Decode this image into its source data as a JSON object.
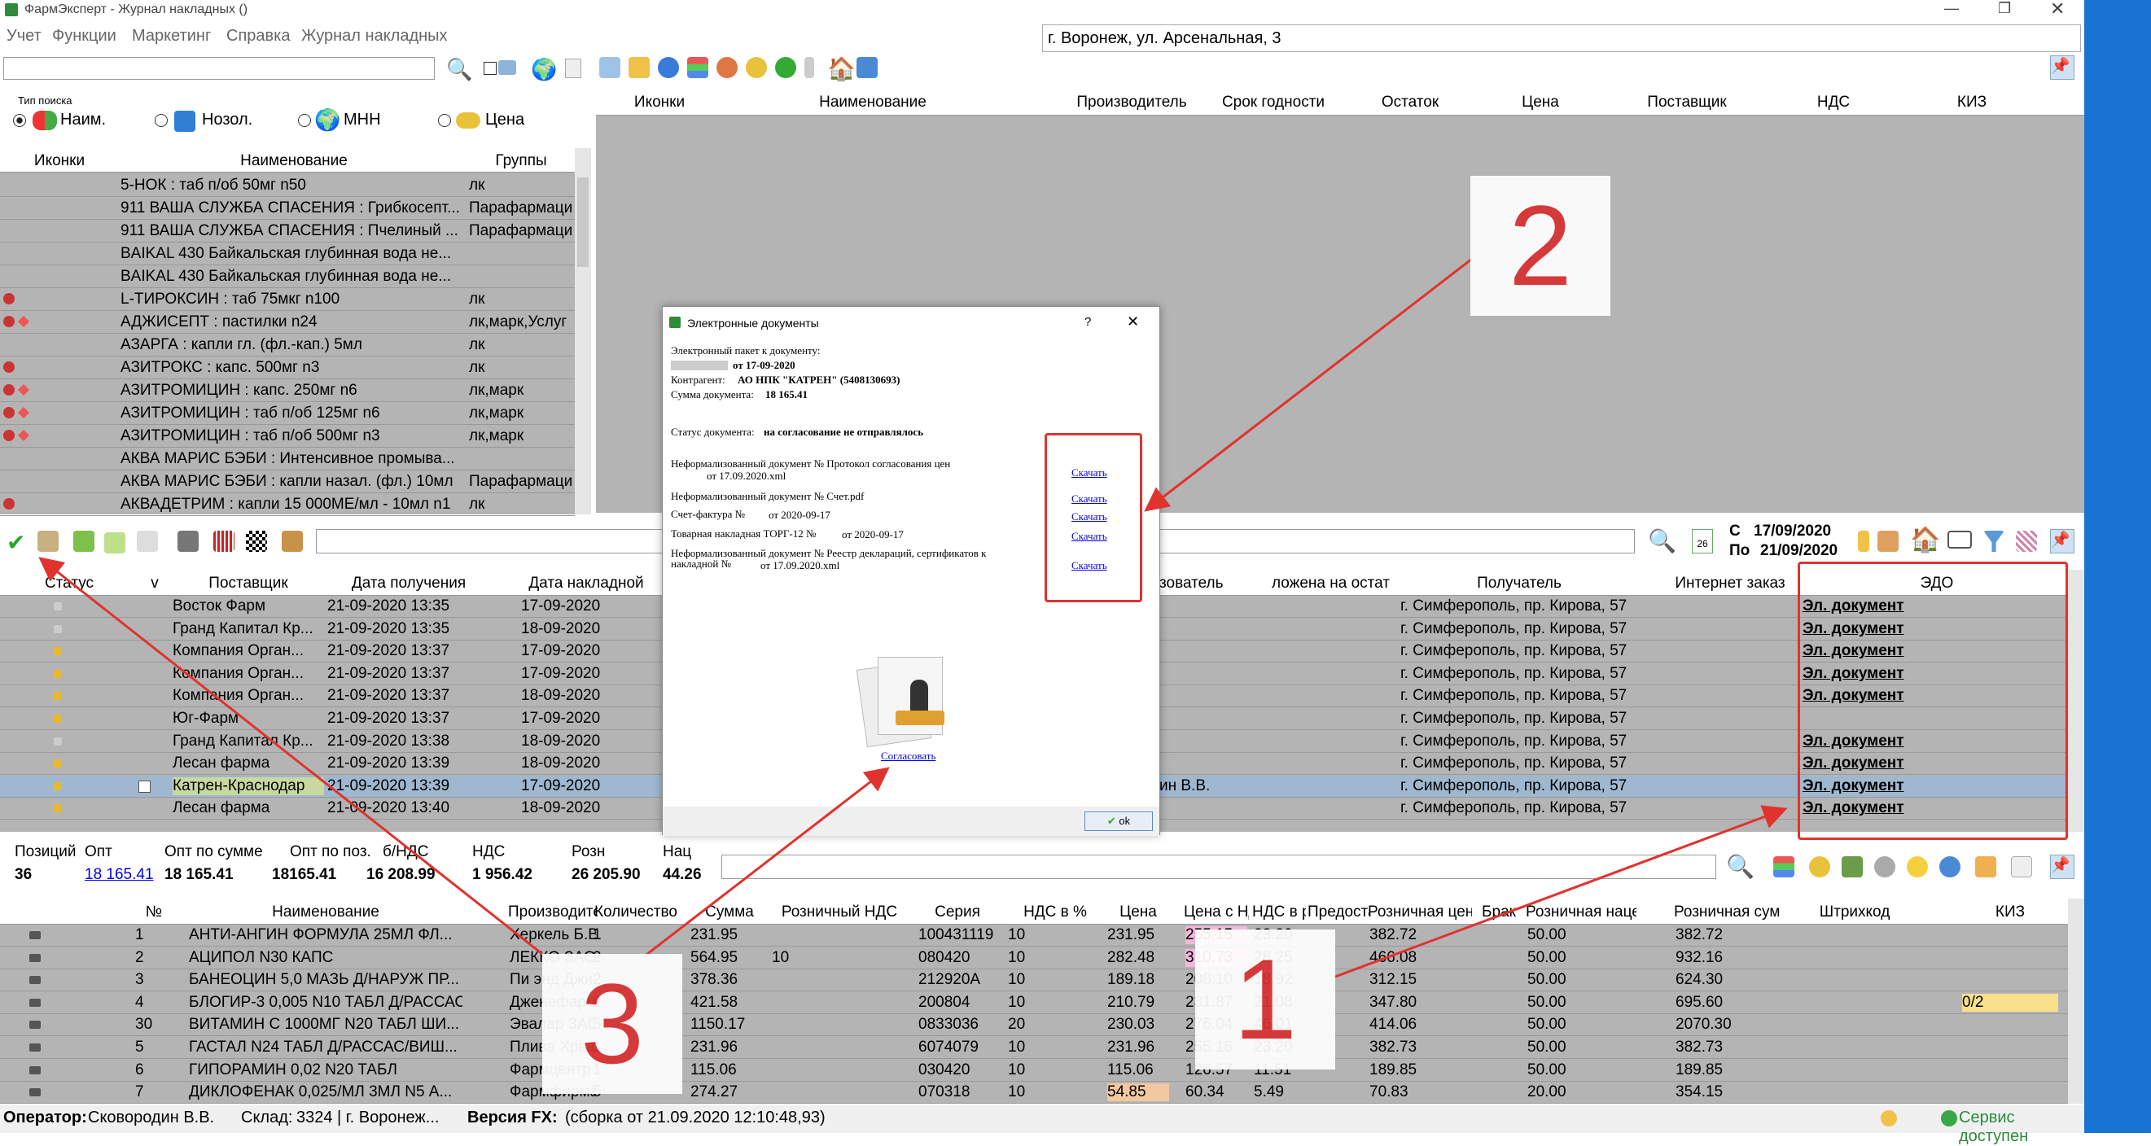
{
  "title": "ФармЭксперт - Журнал накладных ()",
  "menu": [
    "Учет",
    "Функции",
    "Маркетинг",
    "Справка",
    "Журнал накладных"
  ],
  "address": "г. Воронеж, ул. Арсенальная, 3",
  "search_type_label": "Тип поиска",
  "search_types": [
    "Наим.",
    "Нозол.",
    "МНН",
    "Цена"
  ],
  "top_cols": [
    "Иконки",
    "Наименование",
    "Производитель",
    "Срок годности",
    "Остаток",
    "Цена",
    "Поставщик",
    "НДС",
    "КИЗ"
  ],
  "left_cols": [
    "Иконки",
    "Наименование",
    "Группы"
  ],
  "left_rows": [
    {
      "name": "5-НОК : таб п/об 50мг n50",
      "grp": "лк"
    },
    {
      "name": "911 ВАША СЛУЖБА СПАСЕНИЯ : Грибкосепт...",
      "grp": "Парафармаци"
    },
    {
      "name": "911 ВАША СЛУЖБА СПАСЕНИЯ : Пчелиный ...",
      "grp": "Парафармаци"
    },
    {
      "name": "BAIKAL 430 Байкальская глубинная вода  не...",
      "grp": ""
    },
    {
      "name": "BAIKAL 430 Байкальская глубинная вода  не...",
      "grp": ""
    },
    {
      "name": "L-ТИРОКСИН : таб 75мкг n100",
      "grp": "лк"
    },
    {
      "name": "АДЖИСЕПТ : пастилки n24",
      "grp": "лк,марк,Услуг"
    },
    {
      "name": "АЗАРГА : капли гл. (фл.-кап.) 5мл",
      "grp": "лк"
    },
    {
      "name": "АЗИТРОКС : капс. 500мг n3",
      "grp": "лк"
    },
    {
      "name": "АЗИТРОМИЦИН : капс. 250мг n6",
      "grp": "лк,марк"
    },
    {
      "name": "АЗИТРОМИЦИН : таб п/об 125мг n6",
      "grp": "лк,марк"
    },
    {
      "name": "АЗИТРОМИЦИН : таб п/об 500мг n3",
      "grp": "лк,марк"
    },
    {
      "name": "АКВА МАРИС БЭБИ : Интенсивное промыва...",
      "grp": ""
    },
    {
      "name": "АКВА МАРИС БЭБИ : капли назал. (фл.) 10мл",
      "grp": "Парафармаци"
    },
    {
      "name": "АКВАДЕТРИМ : капли 15 000МЕ/мл - 10мл n1",
      "grp": "лк"
    }
  ],
  "date_from_label": "С",
  "date_from": "17/09/2020",
  "date_to_label": "По",
  "date_to": "21/09/2020",
  "cal_day": "26",
  "inv_cols": [
    "Статус",
    "v",
    "Поставщик",
    "Дата получения",
    "Дата накладной",
    "зователь",
    "ложена на остат",
    "Получатель",
    "Интернет заказ",
    "ЭДО"
  ],
  "inv_rows": [
    {
      "sup": "Восток Фарм",
      "recv": "21-09-2020 13:35",
      "inv": "17-09-2020",
      "user": "",
      "recp": "г. Симферополь, пр. Кирова, 57",
      "edo": "Эл. документ"
    },
    {
      "sup": "Гранд Капитал Кр...",
      "recv": "21-09-2020 13:35",
      "inv": "18-09-2020",
      "user": "",
      "recp": "г. Симферополь, пр. Кирова, 57",
      "edo": "Эл. документ"
    },
    {
      "sup": "Компания Орган...",
      "recv": "21-09-2020 13:37",
      "inv": "17-09-2020",
      "user": "",
      "recp": "г. Симферополь, пр. Кирова, 57",
      "edo": "Эл. документ"
    },
    {
      "sup": "Компания Орган...",
      "recv": "21-09-2020 13:37",
      "inv": "17-09-2020",
      "user": "",
      "recp": "г. Симферополь, пр. Кирова, 57",
      "edo": "Эл. документ"
    },
    {
      "sup": "Компания Орган...",
      "recv": "21-09-2020 13:37",
      "inv": "18-09-2020",
      "user": "",
      "recp": "г. Симферополь, пр. Кирова, 57",
      "edo": "Эл. документ"
    },
    {
      "sup": "Юг-Фарм",
      "recv": "21-09-2020 13:37",
      "inv": "17-09-2020",
      "user": "",
      "recp": "г. Симферополь, пр. Кирова, 57",
      "edo": ""
    },
    {
      "sup": "Гранд Капитал Кр...",
      "recv": "21-09-2020 13:38",
      "inv": "18-09-2020",
      "user": "",
      "recp": "г. Симферополь, пр. Кирова, 57",
      "edo": "Эл. документ"
    },
    {
      "sup": "Лесан фарма",
      "recv": "21-09-2020 13:39",
      "inv": "18-09-2020",
      "user": "",
      "recp": "г. Симферополь, пр. Кирова, 57",
      "edo": "Эл. документ"
    },
    {
      "sup": "Катрен-Краснодар",
      "recv": "21-09-2020 13:39",
      "inv": "17-09-2020",
      "user": "ин В.В.",
      "recp": "г. Симферополь, пр. Кирова, 57",
      "edo": "Эл. документ"
    },
    {
      "sup": "Лесан фарма",
      "recv": "21-09-2020 13:40",
      "inv": "18-09-2020",
      "user": "",
      "recp": "г. Симферополь, пр. Кирова, 57",
      "edo": "Эл. документ"
    }
  ],
  "summary": {
    "labels": [
      "Позиций",
      "Опт",
      "Опт по сумме",
      "Опт по поз.",
      "б/НДС",
      "НДС",
      "Розн",
      "Нац"
    ],
    "positions": "36",
    "opt": "18 165.41",
    "opt_sum": "18 165.41",
    "opt_pos": "18165.41",
    "no_vat": "16 208.99",
    "vat": "1 956.42",
    "retail": "26 205.90",
    "markup": "44.26"
  },
  "item_cols": [
    "№",
    "Наименование",
    "Производитель",
    "Количество",
    "Сумма",
    "Розничный НДС",
    "Серия",
    "НДС в %",
    "Цена",
    "Цена с НДС",
    "НДС в рублях",
    "Предоставл.",
    "Розничная цена",
    "Брак",
    "Розничная наценка",
    "Розничная сумма",
    "Штрихкод",
    "КИЗ"
  ],
  "item_rows": [
    {
      "n": "1",
      "name": "АНТИ-АНГИН ФОРМУЛА 25МЛ ФЛ...",
      "mfr": "Херкель Б.В.",
      "qty": "1",
      "sum": "231.95",
      "rvat": "",
      "ser": "100431119",
      "vat": "10",
      "price": "231.95",
      "pvat": "255.15",
      "vrub": "23.20",
      "rprice": "382.72",
      "brak": "",
      "rmark": "50.00",
      "rsum": "382.72",
      "kiz": ""
    },
    {
      "n": "2",
      "name": "АЦИПОЛ N30 КАПС",
      "mfr": "ЛЕККО ЗАО",
      "qty": "2",
      "sum": "564.95",
      "rvat": "10",
      "ser": "080420",
      "vat": "10",
      "price": "282.48",
      "pvat": "310.73",
      "vrub": "28.25",
      "rprice": "466.08",
      "brak": "",
      "rmark": "50.00",
      "rsum": "932.16",
      "kiz": ""
    },
    {
      "n": "3",
      "name": "БАНЕОЦИН 5,0 МАЗЬ Д/НАРУЖ ПР...",
      "mfr": "Пи энд Джи",
      "qty": "2",
      "sum": "378.36",
      "rvat": "",
      "ser": "212920A",
      "vat": "10",
      "price": "189.18",
      "pvat": "208.10",
      "vrub": "18.92",
      "rprice": "312.15",
      "brak": "",
      "rmark": "50.00",
      "rsum": "624.30",
      "kiz": ""
    },
    {
      "n": "4",
      "name": "БЛОГИР-3 0,005 N10 ТАБЛ Д/РАССАС",
      "mfr": "Дженефарм",
      "qty": "2",
      "sum": "421.58",
      "rvat": "",
      "ser": "200804",
      "vat": "10",
      "price": "210.79",
      "pvat": "231.87",
      "vrub": "21.08",
      "rprice": "347.80",
      "brak": "",
      "rmark": "50.00",
      "rsum": "695.60",
      "kiz": "0/2"
    },
    {
      "n": "30",
      "name": "ВИТАМИН С 1000МГ N20 ТАБЛ ШИ...",
      "mfr": "Эвалар ЗАО",
      "qty": "5",
      "sum": "1150.17",
      "rvat": "",
      "ser": "0833036",
      "vat": "20",
      "price": "230.03",
      "pvat": "276.04",
      "vrub": "46.01",
      "rprice": "414.06",
      "brak": "",
      "rmark": "50.00",
      "rsum": "2070.30",
      "kiz": ""
    },
    {
      "n": "5",
      "name": "ГАСТАЛ N24 ТАБЛ Д/РАССАС/ВИШ...",
      "mfr": "Плива Хрват",
      "qty": "1",
      "sum": "231.96",
      "rvat": "",
      "ser": "6074079",
      "vat": "10",
      "price": "231.96",
      "pvat": "255.16",
      "vrub": "23.20",
      "rprice": "382.73",
      "brak": "",
      "rmark": "50.00",
      "rsum": "382.73",
      "kiz": ""
    },
    {
      "n": "6",
      "name": "ГИПОРАМИН 0,02 N20 ТАБЛ",
      "mfr": "Фармцентр",
      "qty": "1",
      "sum": "115.06",
      "rvat": "",
      "ser": "030420",
      "vat": "10",
      "price": "115.06",
      "pvat": "126.57",
      "vrub": "11.51",
      "rprice": "189.85",
      "brak": "",
      "rmark": "50.00",
      "rsum": "189.85",
      "kiz": ""
    },
    {
      "n": "7",
      "name": "ДИКЛОФЕНАК 0,025/МЛ 3МЛ N5 А...",
      "mfr": "Фармфирма",
      "qty": "5",
      "sum": "274.27",
      "rvat": "",
      "ser": "070318",
      "vat": "10",
      "price": "54.85",
      "pvat": "60.34",
      "vrub": "5.49",
      "rprice": "70.83",
      "brak": "",
      "rmark": "20.00",
      "rsum": "354.15",
      "kiz": ""
    }
  ],
  "status": {
    "op_label": "Оператор:",
    "op": "Сковородин В.В.",
    "wh_label": "Склад:",
    "wh": "3324 | г. Воронеж...",
    "ver_label": "Версия FX:",
    "ver": "(сборка от 21.09.2020 12:10:48,93)",
    "service": "Сервис доступен"
  },
  "dialog": {
    "title": "Электронные документы",
    "help": "?",
    "line1": "Электронный пакет к документу:",
    "line2": "от 17-09-2020",
    "contr_label": "Контрагент:",
    "contr": "АО НПК \"КАТРЕН\" (5408130693)",
    "sum_label": "Сумма документа:",
    "sum": "18 165.41",
    "status_label": "Статус документа:",
    "status": "на согласование не отправлялось",
    "docs": [
      {
        "text": "Неформализованный документ № Протокол согласования цен",
        "text2": "от 17.09.2020.xml",
        "link": "Скачать"
      },
      {
        "text": "Неформализованный документ № Счет.pdf",
        "text2": "",
        "link": "Скачать"
      },
      {
        "text": "Счет-фактура №",
        "text2": "от 2020-09-17",
        "link": "Скачать"
      },
      {
        "text": "Товарная накладная ТОРГ-12 №",
        "text2": "от 2020-09-17",
        "link": "Скачать"
      },
      {
        "text": "Неформализованный документ № Реестр деклараций, сертификатов к накладной №",
        "text2": "от 17.09.2020.xml",
        "link": "Скачать"
      }
    ],
    "agree": "Согласовать",
    "ok": "ok"
  },
  "annotations": [
    "1",
    "2",
    "3"
  ]
}
